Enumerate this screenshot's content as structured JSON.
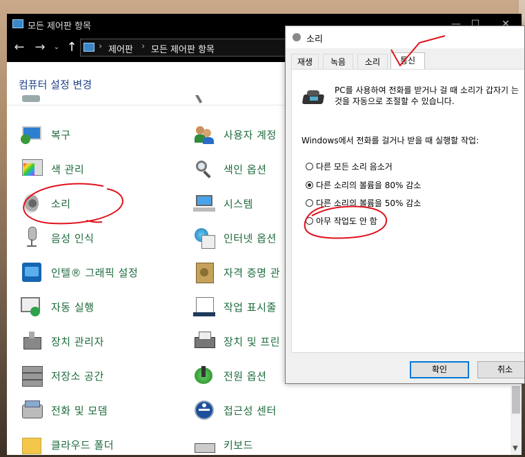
{
  "cp": {
    "title": "모든 제어판 항목",
    "breadcrumb": [
      "제어판",
      "모든 제어판 항목"
    ],
    "header": "컴퓨터 설정 변경",
    "items_left": [
      {
        "label": "복구",
        "icon": "recovery-icon"
      },
      {
        "label": "색 관리",
        "icon": "color-management-icon"
      },
      {
        "label": "소리",
        "icon": "speaker-icon"
      },
      {
        "label": "음성 인식",
        "icon": "microphone-icon"
      },
      {
        "label": "인텔® 그래픽 설정",
        "icon": "intel-graphics-icon"
      },
      {
        "label": "자동 실행",
        "icon": "autoplay-icon"
      },
      {
        "label": "장치 관리자",
        "icon": "device-manager-icon"
      },
      {
        "label": "저장소 공간",
        "icon": "storage-spaces-icon"
      },
      {
        "label": "전화 및 모뎀",
        "icon": "phone-modem-icon"
      },
      {
        "label": "클라우드 폴더",
        "icon": "cloud-folder-icon"
      }
    ],
    "items_right": [
      {
        "label": "사용자 계정",
        "icon": "user-accounts-icon"
      },
      {
        "label": "색인 옵션",
        "icon": "indexing-options-icon"
      },
      {
        "label": "시스템",
        "icon": "system-icon"
      },
      {
        "label": "인터넷 옵션",
        "icon": "internet-options-icon"
      },
      {
        "label": "자격 증명 관",
        "icon": "credential-manager-icon"
      },
      {
        "label": "작업 표시줄",
        "icon": "taskbar-icon"
      },
      {
        "label": "장치 및 프린",
        "icon": "devices-printers-icon"
      },
      {
        "label": "전원 옵션",
        "icon": "power-options-icon"
      },
      {
        "label": "접근성 센터",
        "icon": "ease-of-access-icon"
      },
      {
        "label": "키보드",
        "icon": "keyboard-icon"
      }
    ]
  },
  "dialog": {
    "title": "소리",
    "tabs": [
      "재생",
      "녹음",
      "소리",
      "통신"
    ],
    "active_tab": 3,
    "description": "PC를 사용하여 전화를 받거나 걸 때 소리가 갑자기 는 것을 자동으로 조절할 수 있습니다.",
    "question": "Windows에서 전화를 걸거나 받을 때 실행할 작업:",
    "options": [
      {
        "label": "다른 모든 소리 음소거",
        "selected": false
      },
      {
        "label": "다른 소리의 볼륨을 80% 감소",
        "selected": true
      },
      {
        "label": "다른 소리의 볼륨을 50% 감소",
        "selected": false
      },
      {
        "label": "아무 작업도 안 함",
        "selected": false
      }
    ],
    "ok_label": "확인",
    "cancel_label": "취소"
  },
  "colors": {
    "link_green": "#1c6a3b",
    "header_blue": "#1e3f8a",
    "annotation_red": "#e0101a",
    "focus_blue": "#0078d7"
  }
}
